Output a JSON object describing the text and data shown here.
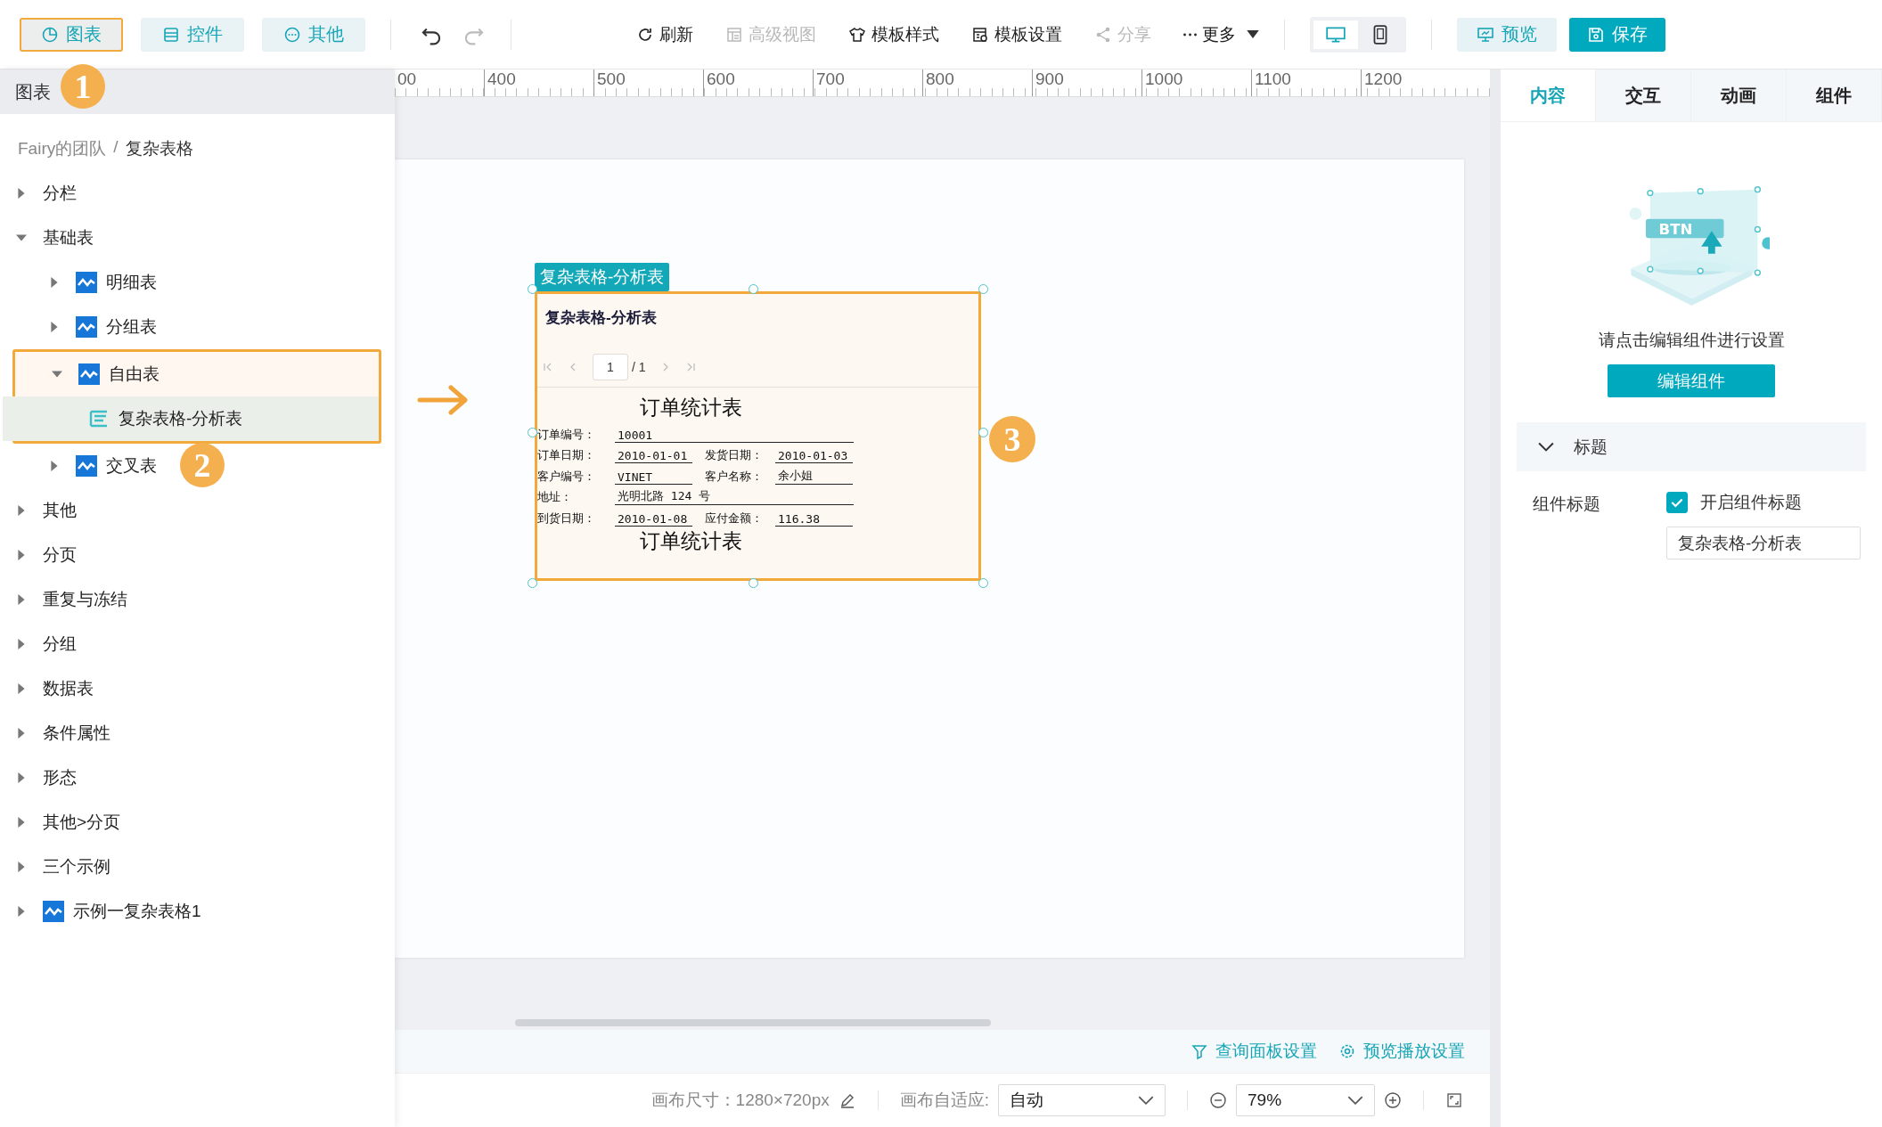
{
  "toolbar": {
    "tabs": [
      {
        "label": "图表",
        "selected": true,
        "kind": "chart"
      },
      {
        "label": "控件",
        "selected": false,
        "kind": "control"
      },
      {
        "label": "其他",
        "selected": false,
        "kind": "other"
      }
    ],
    "actions": [
      {
        "label": "刷新",
        "kind": "refresh",
        "disabled": false
      },
      {
        "label": "高级视图",
        "kind": "view",
        "disabled": true
      },
      {
        "label": "模板样式",
        "kind": "style",
        "disabled": false
      },
      {
        "label": "模板设置",
        "kind": "settings",
        "disabled": false
      },
      {
        "label": "分享",
        "kind": "share",
        "disabled": true
      },
      {
        "label": "更多",
        "kind": "more",
        "disabled": false
      }
    ],
    "devices": [
      {
        "kind": "desktop",
        "selected": true
      },
      {
        "kind": "tablet",
        "selected": false
      }
    ],
    "preview": "预览",
    "save": "保存"
  },
  "annotations": {
    "badge_1": "1",
    "badge_2": "2",
    "badge_3": "3"
  },
  "sidebar": {
    "header": "图表",
    "breadcrumb": {
      "parent": "Fairy的团队",
      "separator": "/",
      "current": "复杂表格"
    },
    "tree": [
      {
        "label": "分栏",
        "kind": "folder",
        "expanded": false,
        "selected": false,
        "annotated": false
      },
      {
        "label": "基础表",
        "kind": "folder",
        "expanded": true,
        "selected": false,
        "annotated": false,
        "children": [
          {
            "label": "明细表",
            "kind": "report",
            "expanded": false,
            "selected": false,
            "annotated": false
          },
          {
            "label": "分组表",
            "kind": "report",
            "expanded": false,
            "selected": false,
            "annotated": false
          },
          {
            "label": "自由表",
            "kind": "report",
            "expanded": true,
            "selected": false,
            "annotated": true,
            "children": [
              {
                "label": "复杂表格-分析表",
                "kind": "sheet",
                "selected": true,
                "annotated": false
              }
            ]
          },
          {
            "label": "交叉表",
            "kind": "report",
            "expanded": false,
            "selected": false,
            "annotated": false
          }
        ]
      },
      {
        "label": "其他",
        "kind": "folder",
        "expanded": false,
        "selected": false,
        "annotated": false
      },
      {
        "label": "分页",
        "kind": "folder",
        "expanded": false,
        "selected": false,
        "annotated": false
      },
      {
        "label": "重复与冻结",
        "kind": "folder",
        "expanded": false,
        "selected": false,
        "annotated": false
      },
      {
        "label": "分组",
        "kind": "folder",
        "expanded": false,
        "selected": false,
        "annotated": false
      },
      {
        "label": "数据表",
        "kind": "folder",
        "expanded": false,
        "selected": false,
        "annotated": false
      },
      {
        "label": "条件属性",
        "kind": "folder",
        "expanded": false,
        "selected": false,
        "annotated": false
      },
      {
        "label": "形态",
        "kind": "folder",
        "expanded": false,
        "selected": false,
        "annotated": false
      },
      {
        "label": "其他>分页",
        "kind": "folder",
        "expanded": false,
        "selected": false,
        "annotated": false
      },
      {
        "label": "三个示例",
        "kind": "folder",
        "expanded": false,
        "selected": false,
        "annotated": false
      },
      {
        "label": "示例一复杂表格1",
        "kind": "report",
        "expanded": false,
        "selected": false,
        "annotated": false
      }
    ]
  },
  "ruler": [
    "00",
    "400",
    "500",
    "600",
    "700",
    "800",
    "900",
    "1000",
    "1100",
    "1200"
  ],
  "canvas": {
    "component": {
      "tag": "复杂表格-分析表",
      "title": "复杂表格-分析表",
      "pager": {
        "page": "1",
        "total": "/ 1"
      },
      "report": {
        "title": "订单统计表",
        "rows": [
          [
            {
              "label": "订单编号：",
              "value": "10001"
            }
          ],
          [
            {
              "label": "订单日期：",
              "value": "2010-01-01"
            },
            {
              "label": "发货日期：",
              "value": "2010-01-03"
            }
          ],
          [
            {
              "label": "客户编号：",
              "value": "VINET"
            },
            {
              "label": "客户名称：",
              "value": "余小姐"
            }
          ],
          [
            {
              "label": "地址：",
              "value": "光明北路 124 号"
            }
          ],
          [
            {
              "label": "到货日期：",
              "value": "2010-01-08"
            },
            {
              "label": "应付金额：",
              "value": "116.38"
            }
          ]
        ],
        "footer_title": "订单统计表"
      }
    }
  },
  "canvas_links": [
    "查询面板设置",
    "预览播放设置"
  ],
  "status_bar": {
    "canvas_size": "画布尺寸：1280×720px",
    "fit_label": "画布自适应:",
    "fit_value": "自动",
    "zoom": "79%"
  },
  "right_panel": {
    "tabs": [
      {
        "label": "内容",
        "selected": true
      },
      {
        "label": "交互",
        "selected": false
      },
      {
        "label": "动画",
        "selected": false
      },
      {
        "label": "组件",
        "selected": false
      }
    ],
    "illustration_text": "BTN",
    "hint": "请点击编辑组件进行设置",
    "edit_button": "编辑组件",
    "section": {
      "title": "标题",
      "expanded": true
    },
    "field_label": "组件标题",
    "checkbox": {
      "label": "开启组件标题",
      "checked": true
    },
    "title_value": "复杂表格-分析表"
  }
}
